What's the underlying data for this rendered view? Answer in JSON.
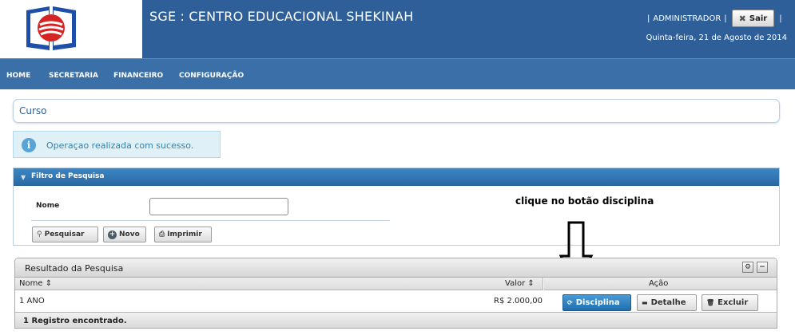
{
  "header": {
    "title": "SGE : CENTRO EDUCACIONAL SHEKINAH",
    "user_sep_left": "|",
    "user": "ADMINISTRADOR",
    "user_sep_mid": "|",
    "logout_label": "Sair",
    "user_sep_right": "|",
    "date": "Quinta-feira, 21 de Agosto de 2014"
  },
  "menu": {
    "items": [
      "HOME",
      "SECRETARIA",
      "FINANCEIRO",
      "CONFIGURAÇÃO"
    ]
  },
  "page": {
    "title": "Curso",
    "message": "Operaçao realizada com sucesso."
  },
  "filter": {
    "title": "Filtro de Pesquisa",
    "nome_label": "Nome",
    "nome_value": "",
    "search_label": "Pesquisar",
    "new_label": "Novo",
    "print_label": "Imprimir"
  },
  "annotation": "clique no botão disciplina",
  "results": {
    "title": "Resultado da Pesquisa",
    "columns": {
      "nome": "Nome",
      "valor": "Valor",
      "acao": "Ação"
    },
    "rows": [
      {
        "nome": "1 ANO",
        "valor": "R$ 2.000,00",
        "actions": {
          "disciplina": "Disciplina",
          "detalhe": "Detalhe",
          "excluir": "Excluir"
        }
      }
    ],
    "footer": "1 Registro encontrado."
  },
  "colors": {
    "header_bg": "#2e5f99",
    "menu_bg": "#3a6fa8",
    "accent": "#1f6fb0",
    "info_bg": "#dff0f7"
  }
}
